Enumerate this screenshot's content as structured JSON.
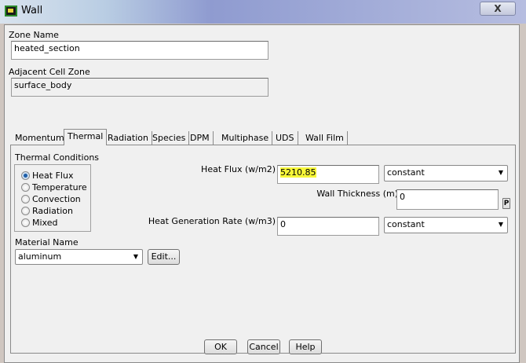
{
  "window": {
    "title": "Wall",
    "close": "X"
  },
  "zone_name": {
    "label": "Zone Name",
    "value": "heated_section"
  },
  "adjacent": {
    "label": "Adjacent Cell Zone",
    "value": "surface_body"
  },
  "tabs": [
    "Momentum",
    "Thermal",
    "Radiation",
    "Species",
    "DPM",
    "Multiphase",
    "UDS",
    "Wall Film"
  ],
  "thermal": {
    "conditions_label": "Thermal Conditions",
    "options": [
      "Heat Flux",
      "Temperature",
      "Convection",
      "Radiation",
      "Mixed"
    ],
    "selected": "Heat Flux",
    "heat_flux": {
      "label": "Heat Flux (w/m2)",
      "value": "5210.85",
      "mode": "constant"
    },
    "wall_thickness": {
      "label": "Wall Thickness (m)",
      "value": "0",
      "p_button": "P"
    },
    "heat_gen": {
      "label": "Heat Generation Rate (w/m3)",
      "value": "0",
      "mode": "constant"
    },
    "material": {
      "label": "Material Name",
      "value": "aluminum",
      "edit": "Edit..."
    }
  },
  "buttons": {
    "ok": "OK",
    "cancel": "Cancel",
    "help": "Help"
  }
}
